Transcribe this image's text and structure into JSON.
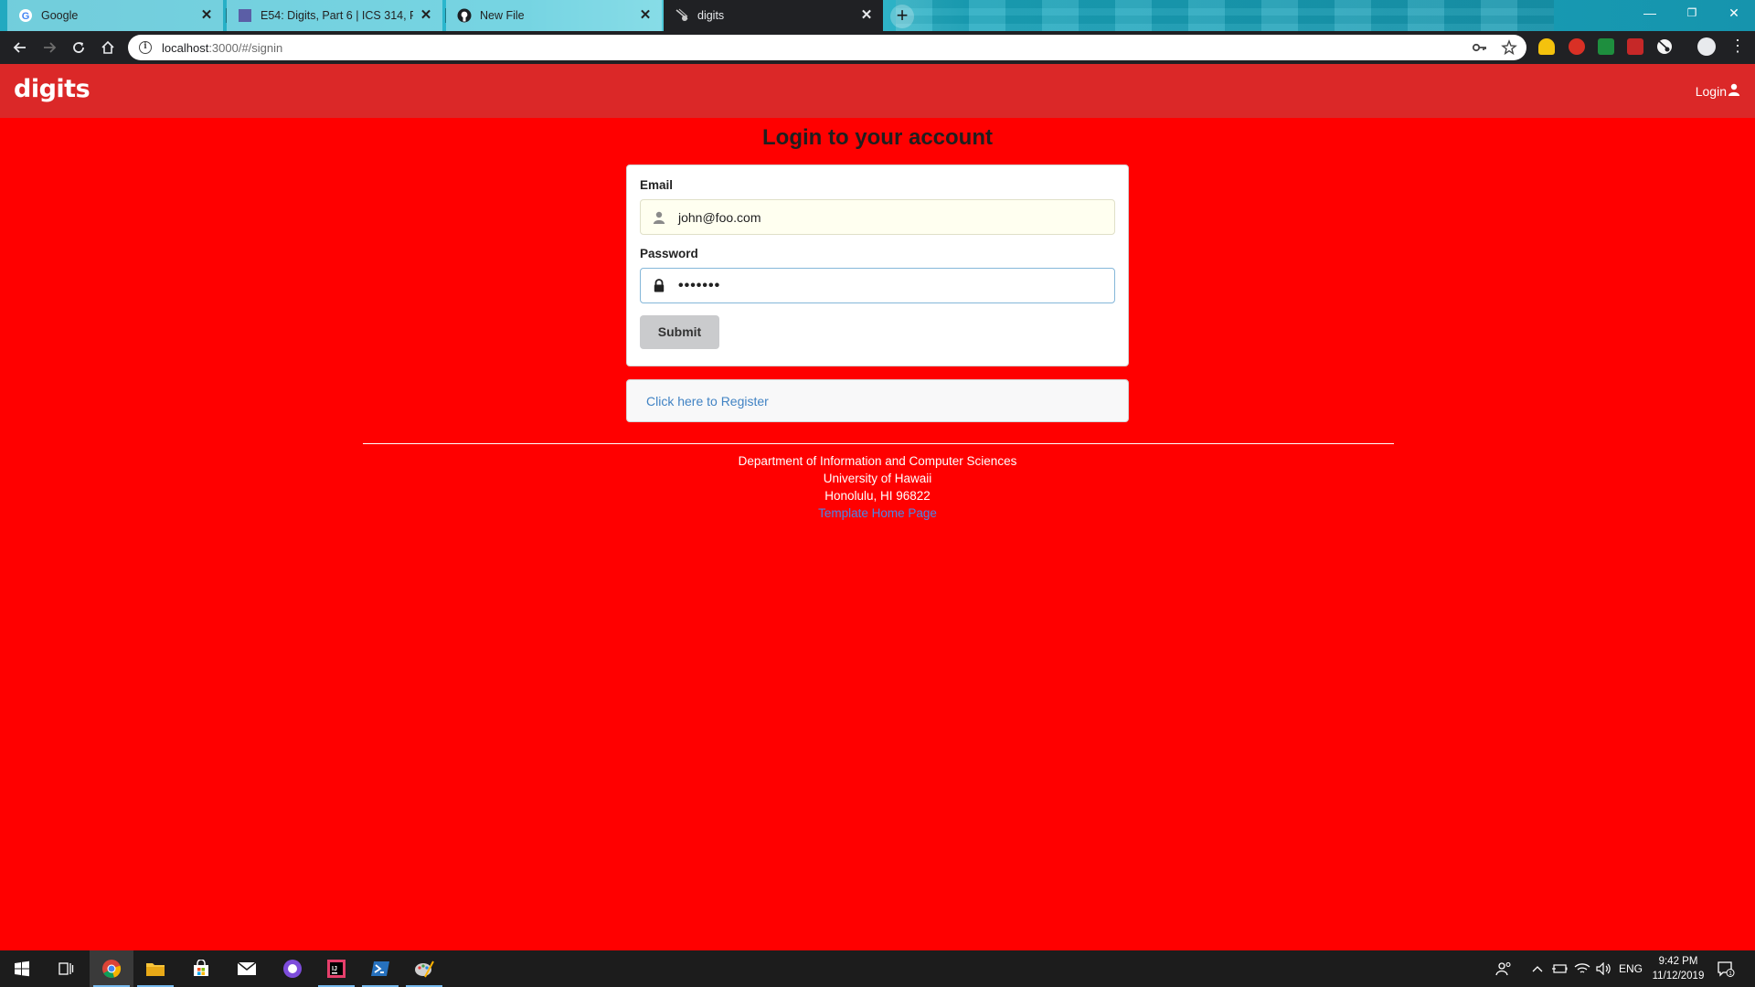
{
  "browser": {
    "tabs": [
      {
        "title": "Google",
        "state": "inactive"
      },
      {
        "title": "E54: Digits, Part 6 | ICS 314, Fall 2",
        "state": "inactive"
      },
      {
        "title": "New File",
        "state": "inactive"
      },
      {
        "title": "digits",
        "state": "active"
      }
    ],
    "url_host": "localhost",
    "url_path": ":3000/#/signin",
    "window_controls": {
      "minimize": "—",
      "restore": "❐",
      "close": "✕"
    }
  },
  "navbar": {
    "brand": "digits",
    "login_label": "Login"
  },
  "signin": {
    "title": "Login to your account",
    "email_label": "Email",
    "email_value": "john@foo.com",
    "password_label": "Password",
    "password_value": "•••••••",
    "submit_label": "Submit",
    "register_link": "Click here to Register"
  },
  "footer": {
    "line1": "Department of Information and Computer Sciences",
    "line2": "University of Hawaii",
    "line3": "Honolulu, HI 96822",
    "link": "Template Home Page"
  },
  "taskbar": {
    "language": "ENG",
    "time": "9:42 PM",
    "date": "11/12/2019",
    "notification_count": "1"
  },
  "colors": {
    "page_background": "#ff0000",
    "navbar": "#db2828",
    "link": "#4183c4"
  }
}
